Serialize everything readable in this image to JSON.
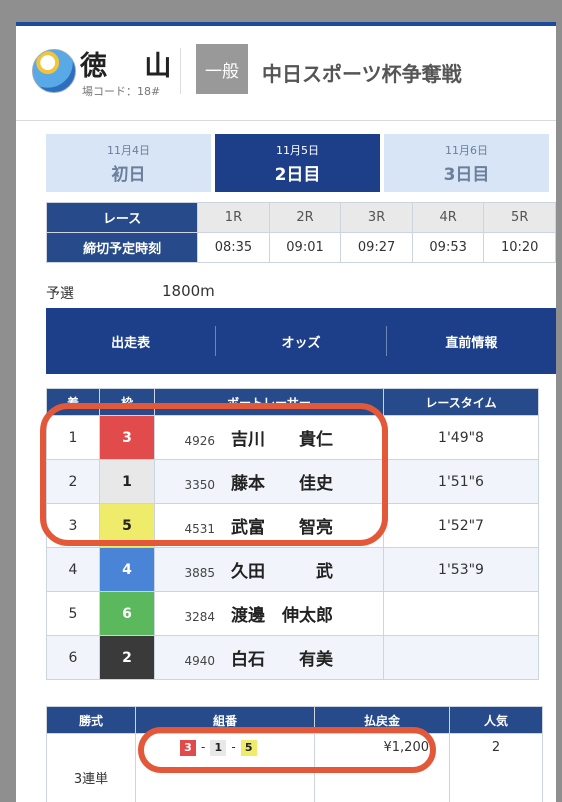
{
  "venue": {
    "name": "徳 山",
    "code_label": "場コード：18#"
  },
  "race_grade": "一般",
  "race_name": "中日スポーツ杯争奪戦",
  "days": [
    {
      "date": "11月4日",
      "label": "初日",
      "active": false
    },
    {
      "date": "11月5日",
      "label": "2日目",
      "active": true
    },
    {
      "date": "11月6日",
      "label": "3日目",
      "active": false
    }
  ],
  "schedule": {
    "race_header": "レース",
    "deadline_header": "締切予定時刻",
    "races": [
      "1R",
      "2R",
      "3R",
      "4R",
      "5R"
    ],
    "times": [
      "08:35",
      "09:01",
      "09:27",
      "09:53",
      "10:20"
    ]
  },
  "race_info": {
    "type": "予選",
    "distance": "1800m"
  },
  "tabs": [
    "出走表",
    "オッズ",
    "直前情報"
  ],
  "results": {
    "headers": {
      "rank": "着",
      "boat": "枠",
      "racer": "ボートレーサー",
      "time": "レースタイム"
    },
    "rows": [
      {
        "rank": "1",
        "boat": "3",
        "reg": "4926",
        "name": "吉川　　貴仁",
        "time": "1'49\"8"
      },
      {
        "rank": "2",
        "boat": "1",
        "reg": "3350",
        "name": "藤本　　佳史",
        "time": "1'51\"6"
      },
      {
        "rank": "3",
        "boat": "5",
        "reg": "4531",
        "name": "武富　　智亮",
        "time": "1'52\"7"
      },
      {
        "rank": "4",
        "boat": "4",
        "reg": "3885",
        "name": "久田　　　武",
        "time": "1'53\"9"
      },
      {
        "rank": "5",
        "boat": "6",
        "reg": "3284",
        "name": "渡邊　伸太郎",
        "time": ""
      },
      {
        "rank": "6",
        "boat": "2",
        "reg": "4940",
        "name": "白石　　有美",
        "time": ""
      }
    ]
  },
  "payout": {
    "headers": {
      "bet_type": "勝式",
      "combo": "組番",
      "amount": "払戻金",
      "popularity": "人気"
    },
    "row": {
      "bet_type": "3連単",
      "combo": [
        "3",
        "1",
        "5"
      ],
      "amount": "¥1,200",
      "popularity": "2"
    }
  },
  "boat_colors": {
    "1": {
      "bg": "#e8e8e8",
      "fg": "#222222"
    },
    "2": {
      "bg": "#3a3a3a",
      "fg": "#ffffff"
    },
    "3": {
      "bg": "#e24b4b",
      "fg": "#ffffff"
    },
    "4": {
      "bg": "#4a84d6",
      "fg": "#ffffff"
    },
    "5": {
      "bg": "#eeec6a",
      "fg": "#222222"
    },
    "6": {
      "bg": "#5cb85c",
      "fg": "#ffffff"
    }
  },
  "highlight_color": "#e4583a"
}
